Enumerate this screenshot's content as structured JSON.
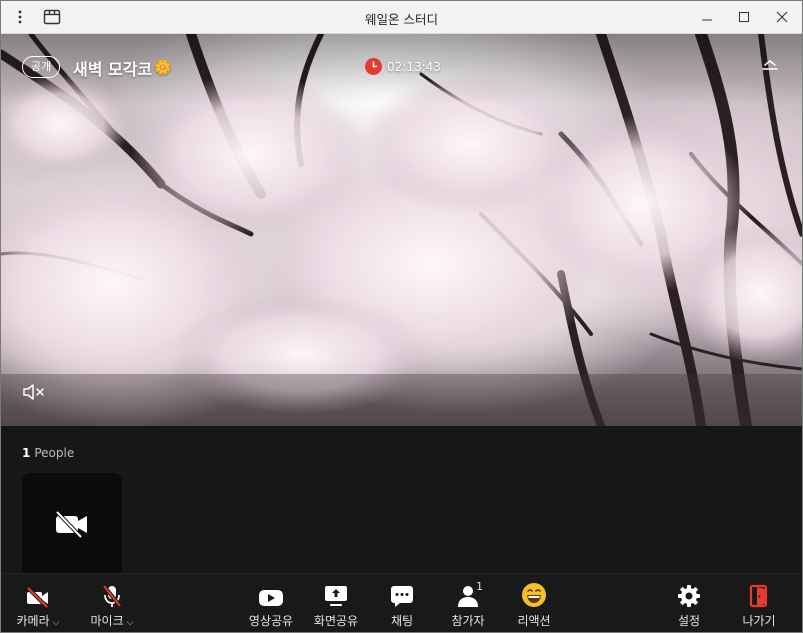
{
  "window": {
    "title": "웨일온 스터디"
  },
  "room": {
    "visibility_badge": "공개",
    "title": "새벽 모각코",
    "title_emoji": "🌼",
    "elapsed_time": "02:13:43"
  },
  "participants": {
    "count": "1",
    "label": "People"
  },
  "toolbar": {
    "camera_label": "카메라",
    "mic_label": "마이크",
    "video_share_label": "영상공유",
    "screen_share_label": "화면공유",
    "chat_label": "채팅",
    "participants_label": "참가자",
    "participants_count": "1",
    "reaction_label": "리액션",
    "settings_label": "설정",
    "leave_label": "나가기"
  },
  "colors": {
    "timer_red": "#e53b2f",
    "leave_red": "#e53b2f",
    "reaction_yellow": "#f5c225",
    "mute_slash_red": "#e53b2f"
  }
}
